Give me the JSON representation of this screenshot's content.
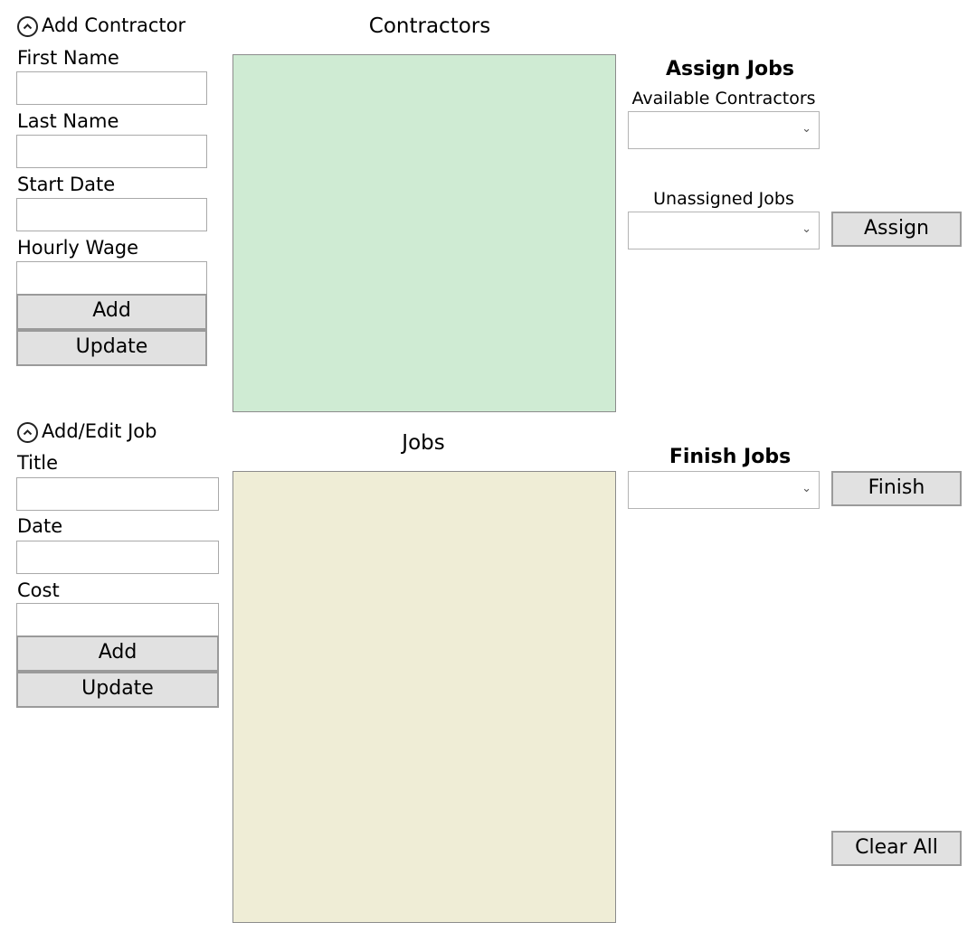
{
  "contractor_form": {
    "header": "Add Contractor",
    "first_name_label": "First Name",
    "last_name_label": "Last Name",
    "start_date_label": "Start Date",
    "hourly_wage_label": "Hourly Wage",
    "first_name_value": "",
    "last_name_value": "",
    "start_date_value": "",
    "hourly_wage_value": "",
    "add_label": "Add",
    "update_label": "Update"
  },
  "job_form": {
    "header": "Add/Edit Job",
    "title_label": "Title",
    "date_label": "Date",
    "cost_label": "Cost",
    "title_value": "",
    "date_value": "",
    "cost_value": "",
    "add_label": "Add",
    "update_label": "Update"
  },
  "contractors_list": {
    "title": "Contractors",
    "background": "#cfebd3",
    "items": []
  },
  "jobs_list": {
    "title": "Jobs",
    "background": "#efedd6",
    "items": []
  },
  "assign_jobs": {
    "heading": "Assign Jobs",
    "available_contractors_label": "Available Contractors",
    "available_contractors_selected": "",
    "unassigned_jobs_label": "Unassigned Jobs",
    "unassigned_jobs_selected": "",
    "assign_label": "Assign"
  },
  "finish_jobs": {
    "heading": "Finish Jobs",
    "selected": "",
    "finish_label": "Finish"
  },
  "clear_all_label": "Clear All",
  "icons": {
    "expander": "chevron-up-circle-icon",
    "combo_arrow": "chevron-down-icon"
  }
}
